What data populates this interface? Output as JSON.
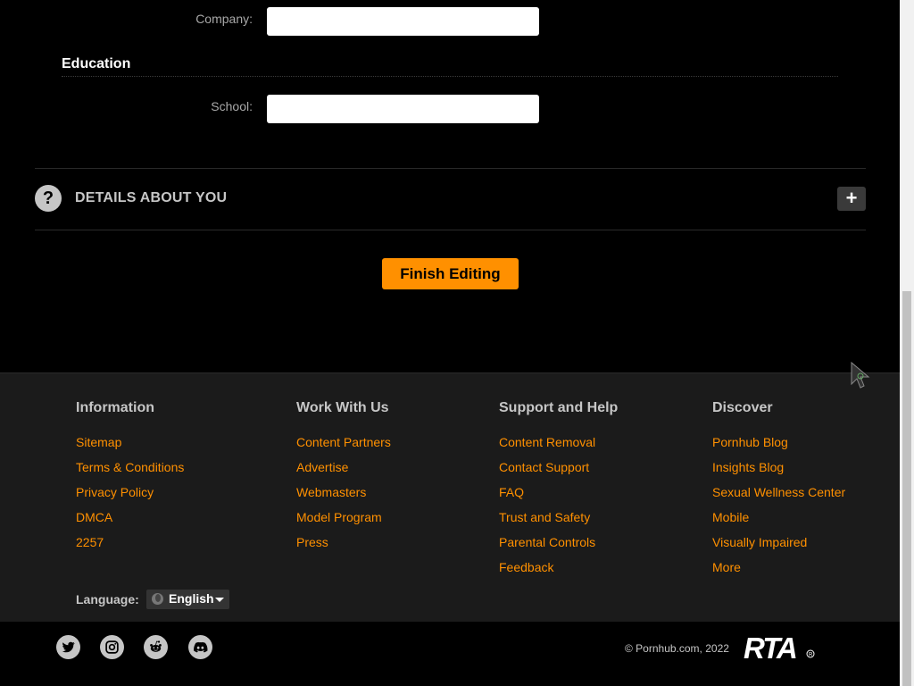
{
  "form": {
    "company_label": "Company:",
    "company_value": "",
    "education_title": "Education",
    "school_label": "School:",
    "school_value": ""
  },
  "details": {
    "title": "DETAILS ABOUT YOU",
    "question_icon": "?",
    "expand_icon": "+"
  },
  "finish_button": "Finish Editing",
  "footer": {
    "columns": [
      {
        "title": "Information",
        "links": [
          "Sitemap",
          "Terms & Conditions",
          "Privacy Policy",
          "DMCA",
          "2257"
        ]
      },
      {
        "title": "Work With Us",
        "links": [
          "Content Partners",
          "Advertise",
          "Webmasters",
          "Model Program",
          "Press"
        ]
      },
      {
        "title": "Support and Help",
        "links": [
          "Content Removal",
          "Contact Support",
          "FAQ",
          "Trust and Safety",
          "Parental Controls",
          "Feedback"
        ]
      },
      {
        "title": "Discover",
        "links": [
          "Pornhub Blog",
          "Insights Blog",
          "Sexual Wellness Center",
          "Mobile",
          "Visually Impaired",
          "More"
        ]
      }
    ],
    "language_label": "Language:",
    "language_value": "English"
  },
  "bottom": {
    "social_icons": [
      "twitter-icon",
      "instagram-icon",
      "reddit-icon",
      "discord-icon"
    ],
    "copyright": "© Pornhub.com, 2022",
    "rta_logo_text": "RTA"
  },
  "colors": {
    "accent": "#ff9000",
    "background": "#000000",
    "footer_bg": "#1b1b1b",
    "muted_text": "#c6c6c6"
  }
}
